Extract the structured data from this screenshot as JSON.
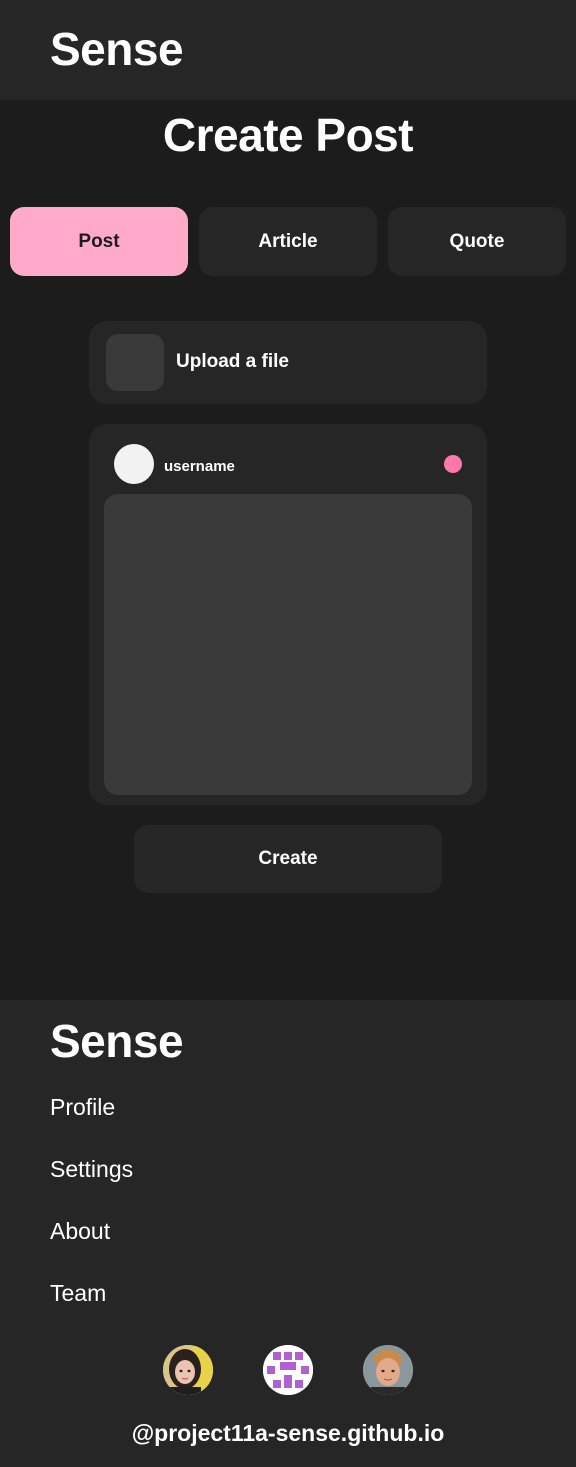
{
  "header": {
    "brand": "Sense"
  },
  "page": {
    "title": "Create Post"
  },
  "tabs": [
    {
      "label": "Post",
      "active": true
    },
    {
      "label": "Article",
      "active": false
    },
    {
      "label": "Quote",
      "active": false
    }
  ],
  "upload": {
    "label": "Upload a file"
  },
  "card": {
    "username": "username",
    "status_color": "#ff78aa"
  },
  "actions": {
    "create_label": "Create"
  },
  "footer": {
    "brand": "Sense",
    "links": [
      "Profile",
      "Settings",
      "About",
      "Team"
    ],
    "team_avatars": [
      "team-member-1-avatar",
      "team-member-2-avatar",
      "team-member-3-avatar"
    ],
    "handle": "@project11a-sense.github.io"
  },
  "colors": {
    "background": "#1c1c1c",
    "surface": "#262626",
    "surface_inner": "#3a3a3a",
    "accent_active_tab": "#ffaac8",
    "text": "#ffffff"
  }
}
